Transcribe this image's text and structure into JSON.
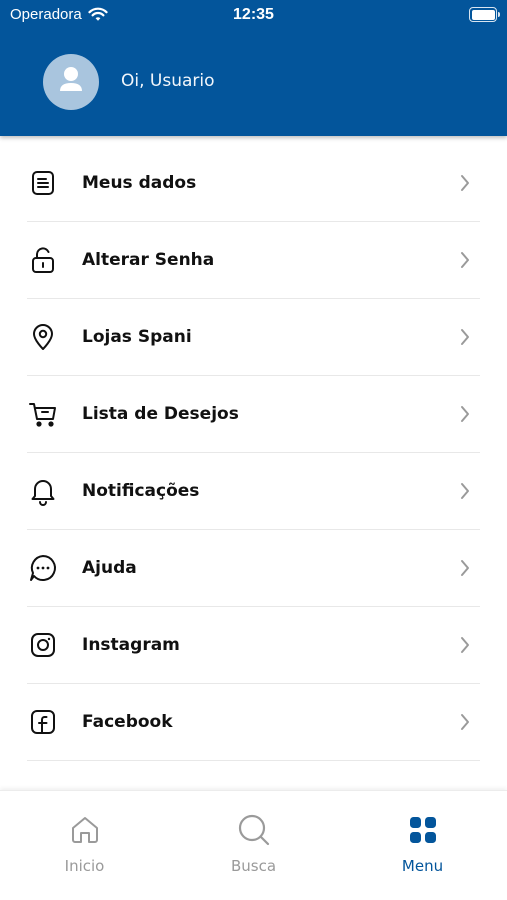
{
  "status_bar": {
    "carrier": "Operadora",
    "time": "12:35"
  },
  "header": {
    "greeting": "Oi, Usuario"
  },
  "menu": {
    "items": [
      {
        "label": "Meus dados",
        "icon": "document-icon"
      },
      {
        "label": "Alterar Senha",
        "icon": "unlock-icon"
      },
      {
        "label": "Lojas Spani",
        "icon": "location-pin-icon"
      },
      {
        "label": "Lista de Desejos",
        "icon": "cart-icon"
      },
      {
        "label": "Notificações",
        "icon": "bell-icon"
      },
      {
        "label": "Ajuda",
        "icon": "chat-bubble-icon"
      },
      {
        "label": "Instagram",
        "icon": "instagram-icon"
      },
      {
        "label": "Facebook",
        "icon": "facebook-icon"
      }
    ]
  },
  "tab_bar": {
    "tabs": [
      {
        "label": "Inicio",
        "icon": "home-icon",
        "active": false
      },
      {
        "label": "Busca",
        "icon": "search-icon",
        "active": false
      },
      {
        "label": "Menu",
        "icon": "grid-icon",
        "active": true
      }
    ]
  },
  "colors": {
    "brand": "#03559b",
    "inactive": "#9a9a9a",
    "avatar_bg": "#a9c5de"
  }
}
